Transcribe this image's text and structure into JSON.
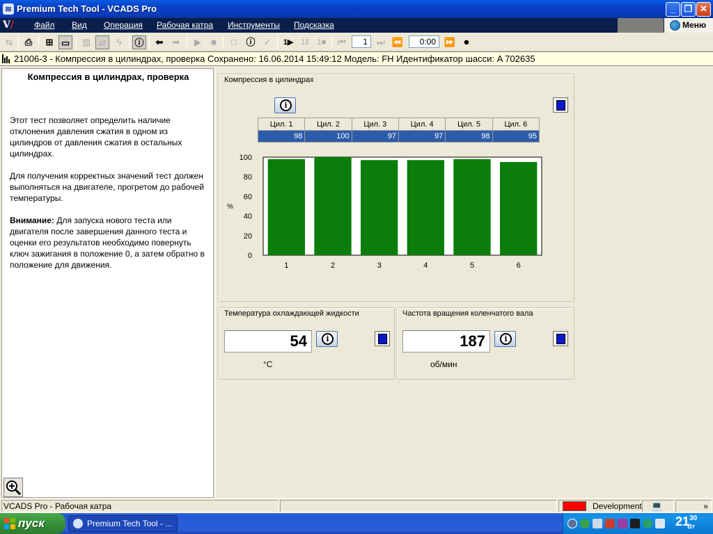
{
  "window": {
    "title": "Premium Tech Tool - VCADS Pro"
  },
  "menu": {
    "items": [
      "Файл",
      "Вид",
      "Операция",
      "Рабочая катра",
      "Инструменты",
      "Подсказка"
    ],
    "menu_button": "Меню"
  },
  "toolbar": {
    "step_value": "1",
    "time_value": "0:00"
  },
  "infobar": {
    "text": "21006-3 - Компрессия в цилиндрах, проверка  Сохранено: 16.06.2014 15:49:12  Модель: FH  Идентификатор шасси: A    702635"
  },
  "left": {
    "title": "Компрессия в цилиндрах, проверка",
    "p1": "Этот тест позволяет определить наличие отклонения давления сжатия в одном из цилиндров от давления сжатия в остальных цилиндрах.",
    "p2": "Для получения корректных значений тест должен выполняться на двигателе, прогретом до рабочей температуры.",
    "p3_bold": "Внимание:",
    "p3_text": " Для запуска нового теста или двигателя после завершения данного теста и оценки его результатов необходимо повернуть ключ зажигания в положение 0, а затем обратно в положение для движения."
  },
  "compression": {
    "group_title": "Компрессия в цилиндрах",
    "table_headers": [
      "Цил. 1",
      "Цил. 2",
      "Цил. 3",
      "Цил. 4",
      "Цил. 5",
      "Цил. 6"
    ],
    "table_values": [
      "98",
      "100",
      "97",
      "97",
      "98",
      "95"
    ]
  },
  "chart_data": {
    "type": "bar",
    "categories": [
      "1",
      "2",
      "3",
      "4",
      "5",
      "6"
    ],
    "values": [
      98,
      100,
      97,
      97,
      98,
      95
    ],
    "title": "",
    "xlabel": "",
    "ylabel": "%",
    "ylim": [
      0,
      100
    ],
    "yticks": [
      "0",
      "20",
      "40",
      "60",
      "80",
      "100"
    ],
    "bar_color": "#0a7d0a",
    "grid": false
  },
  "coolant": {
    "title": "Температура охлаждающей жидкости",
    "value": "54",
    "unit": "°C"
  },
  "rpm": {
    "title": "Частота вращения коленчатого вала",
    "value": "187",
    "unit": "об/мин"
  },
  "status": {
    "left": "VCADS Pro - Рабочая катра",
    "mode": "Development",
    "mode_color": "#ff0000"
  },
  "taskbar": {
    "start": "пуск",
    "task": "Premium Tech Tool - ...",
    "clock_h": "21",
    "clock_m": "30",
    "clock_suffix": "Вт"
  }
}
